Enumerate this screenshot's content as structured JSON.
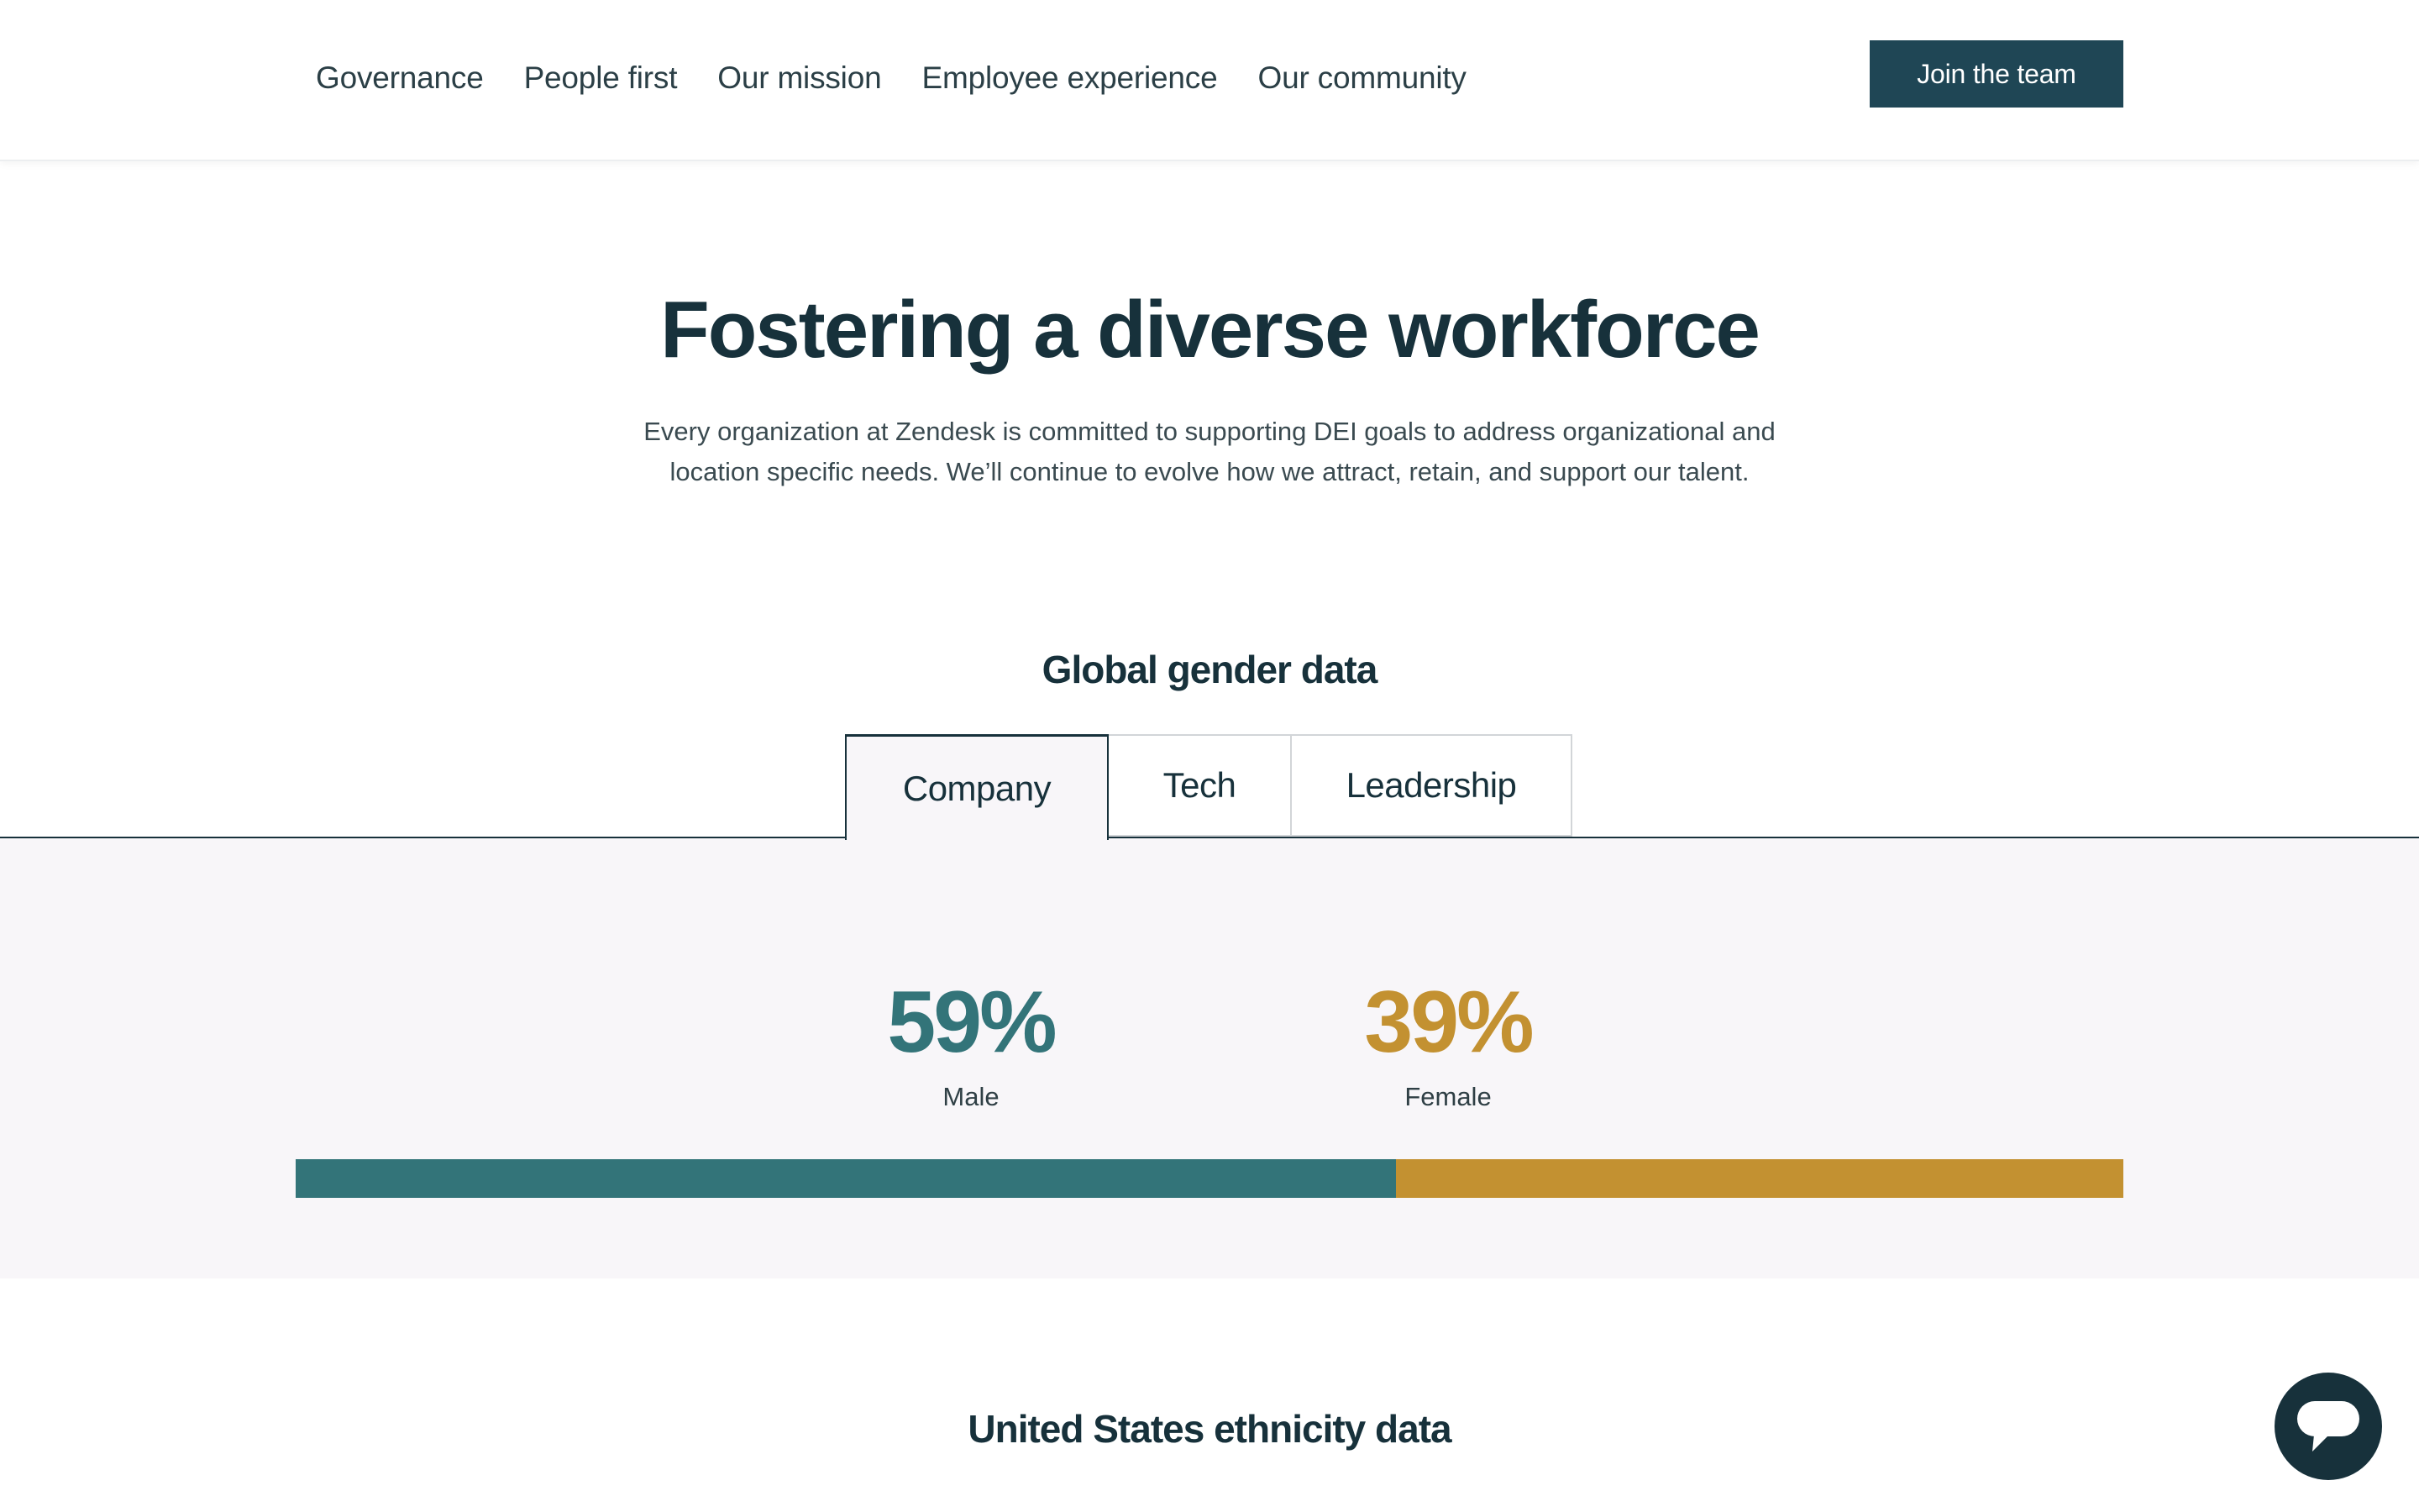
{
  "header": {
    "nav": [
      {
        "label": "Governance"
      },
      {
        "label": "People first"
      },
      {
        "label": "Our mission"
      },
      {
        "label": "Employee experience"
      },
      {
        "label": "Our community"
      }
    ],
    "cta_label": "Join the team"
  },
  "hero": {
    "title": "Fostering a diverse workforce",
    "description": "Every organization at Zendesk is committed to supporting DEI goals to address organizational and location specific needs. We’ll continue to evolve how we attract, retain, and support our talent."
  },
  "gender": {
    "title": "Global gender data",
    "tabs": [
      {
        "label": "Company",
        "active": true
      },
      {
        "label": "Tech",
        "active": false
      },
      {
        "label": "Leadership",
        "active": false
      }
    ],
    "stats": [
      {
        "value": "59%",
        "label": "Male",
        "color": "#337479"
      },
      {
        "value": "39%",
        "label": "Female",
        "color": "#c39131"
      }
    ]
  },
  "chart_data": {
    "type": "bar",
    "categories": [
      "Male",
      "Female"
    ],
    "values": [
      59,
      39
    ],
    "colors": [
      "#337479",
      "#c39131"
    ],
    "stacked": true,
    "orientation": "horizontal"
  },
  "ethnicity": {
    "title": "United States ethnicity data"
  },
  "chat": {
    "icon": "chat-bubble-icon"
  }
}
